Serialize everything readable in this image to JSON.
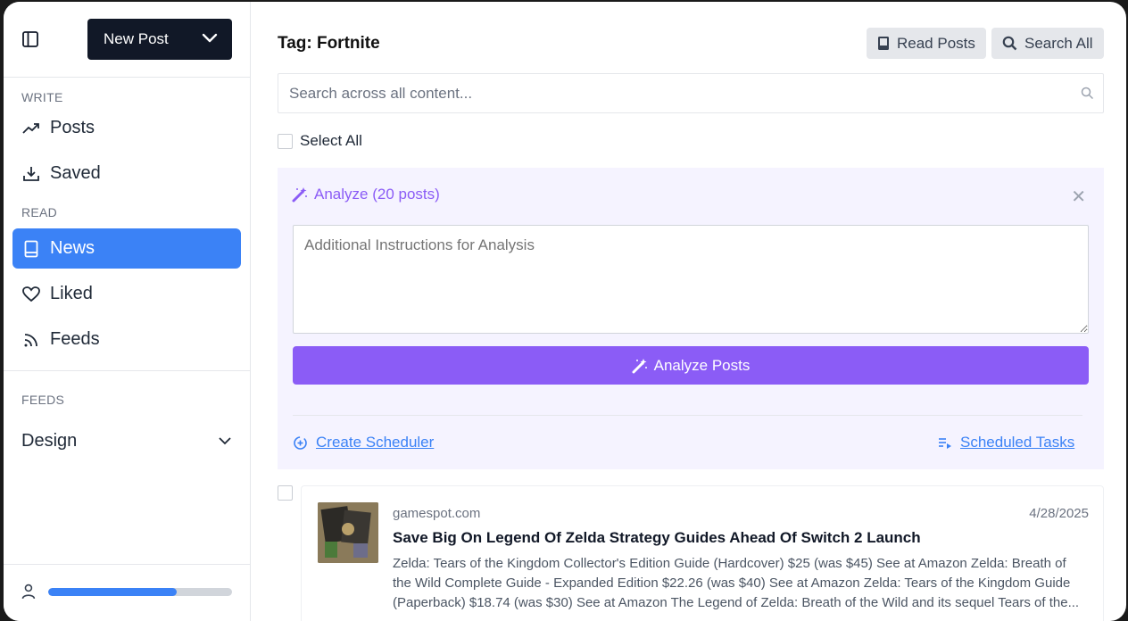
{
  "sidebar": {
    "new_post_label": "New Post",
    "sections": {
      "write": "WRITE",
      "read": "READ",
      "feeds": "FEEDS"
    },
    "items": [
      {
        "label": "Posts",
        "icon": "trending-up-icon"
      },
      {
        "label": "Saved",
        "icon": "download-icon"
      },
      {
        "label": "News",
        "icon": "book-icon",
        "active": true
      },
      {
        "label": "Liked",
        "icon": "heart-icon"
      },
      {
        "label": "Feeds",
        "icon": "rss-icon"
      }
    ],
    "feed_group": "Design",
    "progress": 0.7
  },
  "header": {
    "title": "Tag: Fortnite",
    "read_posts_label": "Read Posts",
    "search_all_label": "Search All"
  },
  "search": {
    "placeholder": "Search across all content..."
  },
  "select_all_label": "Select All",
  "analyze": {
    "heading": "Analyze (20 posts)",
    "placeholder": "Additional Instructions for Analysis",
    "button_label": "Analyze Posts",
    "create_scheduler_label": "Create Scheduler",
    "scheduled_tasks_label": "Scheduled Tasks"
  },
  "post": {
    "source": "gamespot.com",
    "date": "4/28/2025",
    "title": "Save Big On Legend Of Zelda Strategy Guides Ahead Of Switch 2 Launch",
    "excerpt": "Zelda: Tears of the Kingdom Collector's Edition Guide (Hardcover) $25 (was $45) See at Amazon Zelda: Breath of the Wild Complete Guide - Expanded Edition $22.26 (was $40) See at Amazon Zelda: Tears of the Kingdom Guide (Paperback) $18.74 (was $30) See at Amazon The Legend of Zelda: Breath of the Wild and its sequel Tears of the..."
  },
  "colors": {
    "accent": "#3b82f6",
    "purple": "#8b5cf6",
    "dark": "#111827"
  }
}
